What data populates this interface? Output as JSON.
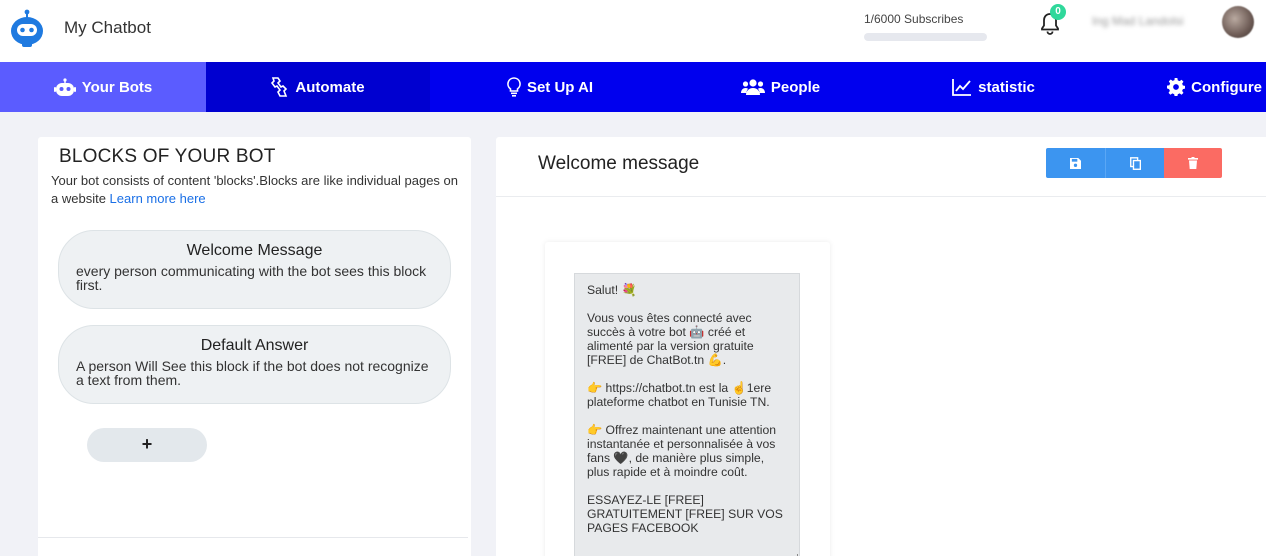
{
  "app": {
    "title": "My Chatbot"
  },
  "subscribers": {
    "text": "1/6000  Subscribes",
    "progress": 0.0002
  },
  "notifications": {
    "count": "0"
  },
  "user": {
    "name": "Ing Mad Landolsi"
  },
  "nav": [
    {
      "label": "Your Bots",
      "icon": "robot-icon",
      "active": true
    },
    {
      "label": "Automate",
      "icon": "automate-icon"
    },
    {
      "label": "Set Up AI",
      "icon": "lightbulb-icon"
    },
    {
      "label": "People",
      "icon": "people-icon"
    },
    {
      "label": "statistic",
      "icon": "chart-line-icon"
    },
    {
      "label": "Configure",
      "icon": "gear-icon"
    }
  ],
  "blocks_panel": {
    "title": "BLOCKS OF YOUR BOT",
    "description": "Your bot consists of content 'blocks'.Blocks are like individual pages on a website ",
    "learn_more": "Learn more here",
    "blocks": [
      {
        "title": "Welcome Message",
        "description": "every person communicating with the bot sees this block first."
      },
      {
        "title": "Default Answer",
        "description": "A person Will See this block if the bot does not recognize a text from them."
      }
    ],
    "add_label": "+"
  },
  "editor": {
    "title": "Welcome message",
    "buttons": {
      "save": "save-icon",
      "copy": "copy-icon",
      "delete": "trash-icon"
    },
    "message_lines": [
      "Salut! 💐",
      "",
      "Vous vous êtes connecté avec succès à votre bot 🤖 créé et alimenté par la version gratuite [FREE] de ChatBot.tn 💪.",
      "",
      "👉 https://chatbot.tn est la ☝️1ere plateforme chatbot en Tunisie TN.",
      "",
      "👉 Offrez maintenant une attention instantanée et personnalisée à vos fans 🖤, de manière plus simple, plus rapide et à moindre coût.",
      "",
      "ESSAYEZ-LE [FREE] GRATUITEMENT [FREE] SUR VOS PAGES FACEBOOK"
    ]
  },
  "colors": {
    "nav_bg": "#0000ee",
    "nav_active": "#5b5cff",
    "save_btn": "#3c95f0",
    "delete_btn": "#fb6b63",
    "link": "#1a6fe6",
    "badge": "#2fd89b"
  }
}
